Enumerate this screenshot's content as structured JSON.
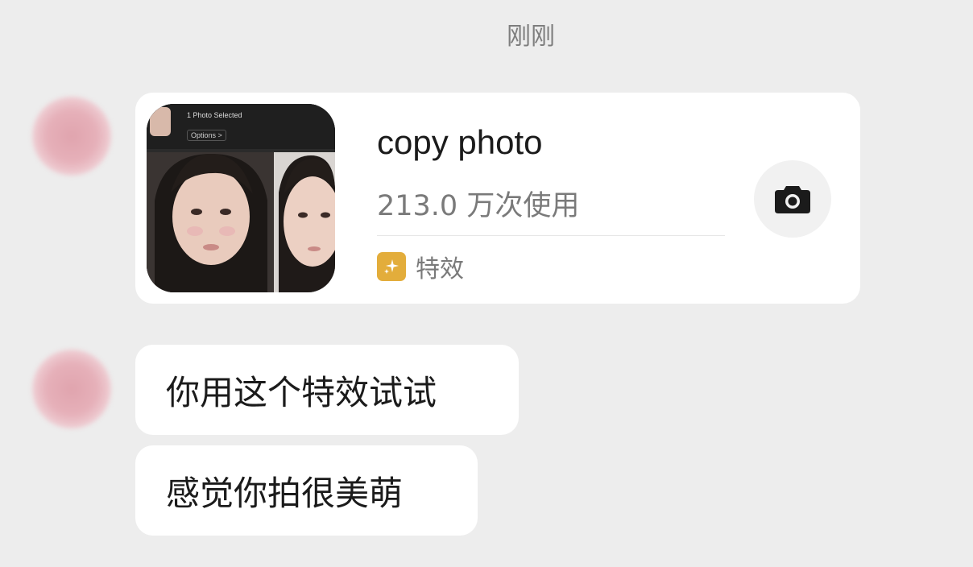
{
  "chat": {
    "timestamp": "刚刚",
    "card": {
      "title": "copy photo",
      "usage": "213.0 万次使用",
      "tag_label": "特效",
      "tag_icon": "sparkle-icon",
      "action_icon": "camera-icon",
      "thumbnail": {
        "header_text": "1 Photo Selected",
        "options_text": "Options >"
      }
    },
    "messages": [
      {
        "text": "你用这个特效试试"
      },
      {
        "text": "感觉你拍很美萌"
      }
    ]
  },
  "colors": {
    "background": "#ededed",
    "bubble": "#ffffff",
    "tag_icon_bg": "#e3ad3b",
    "secondary_text": "#7a7a7a"
  }
}
